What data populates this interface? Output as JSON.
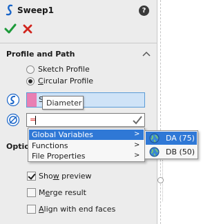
{
  "window": {
    "title": "Sweep1",
    "help_icon": "question-mark-icon",
    "ok_icon": "green-check-icon",
    "cancel_icon": "red-x-icon"
  },
  "profile_and_path": {
    "title": "Profile and Path",
    "options": [
      {
        "pre": "",
        "mnemonic": "",
        "post": "Sketch Profile",
        "selected": false
      },
      {
        "pre": "",
        "mnemonic": "C",
        "post": "ircular Profile",
        "selected": true
      }
    ],
    "profile_field_text": "S",
    "tooltip": "Diameter",
    "diameter_value": "="
  },
  "context_menu": {
    "items": [
      {
        "label": "Global Variables",
        "arrow": ">",
        "active": true
      },
      {
        "label": "Functions",
        "arrow": ">",
        "active": false
      },
      {
        "label": "File Properties",
        "arrow": ">",
        "active": false
      }
    ],
    "submenu": [
      {
        "label": "DA (75)",
        "active": true
      },
      {
        "label": "DB (50)",
        "active": false
      }
    ]
  },
  "options_group": {
    "title": "Optio",
    "checkboxes": [
      {
        "pre": "Sho",
        "mnemonic": "w",
        "post": " preview",
        "checked": true
      },
      {
        "pre": "M",
        "mnemonic": "e",
        "post": "rge result",
        "checked": false
      },
      {
        "pre": "",
        "mnemonic": "A",
        "post": "lign with end faces",
        "checked": false
      }
    ]
  },
  "colors": {
    "accent": "#2f78d6",
    "profile_swatch": "#e97fb3",
    "selection_field": "#cfe3f7",
    "ok_green": "#1d9a3a",
    "cancel_red": "#d0241d"
  }
}
